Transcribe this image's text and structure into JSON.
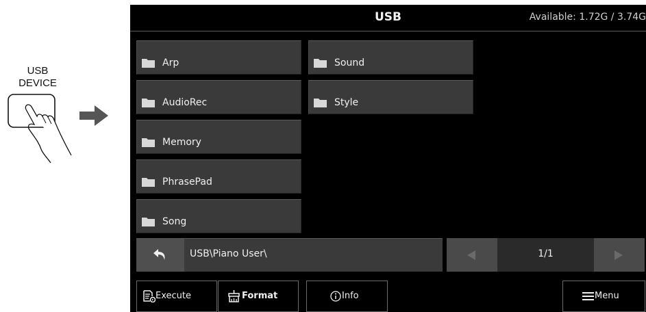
{
  "illustration": {
    "caption_line1": "USB",
    "caption_line2": "DEVICE"
  },
  "header": {
    "title": "USB",
    "available": "Available: 1.72G / 3.74G"
  },
  "folders": [
    {
      "name": "Arp"
    },
    {
      "name": "AudioRec"
    },
    {
      "name": "Memory"
    },
    {
      "name": "PhrasePad"
    },
    {
      "name": "Song"
    },
    {
      "name": "Sound"
    },
    {
      "name": "Style"
    }
  ],
  "path": {
    "current": "USB\\Piano User\\"
  },
  "pager": {
    "page": "1/1"
  },
  "toolbar": {
    "execute": "Execute",
    "format": "Format",
    "info": "Info",
    "menu": "Menu"
  },
  "colors": {
    "screen_bg": "#000000",
    "button_bg": "#3a3a3a",
    "accent_btn": "#4f4f4f",
    "text": "#f0f0f0"
  }
}
